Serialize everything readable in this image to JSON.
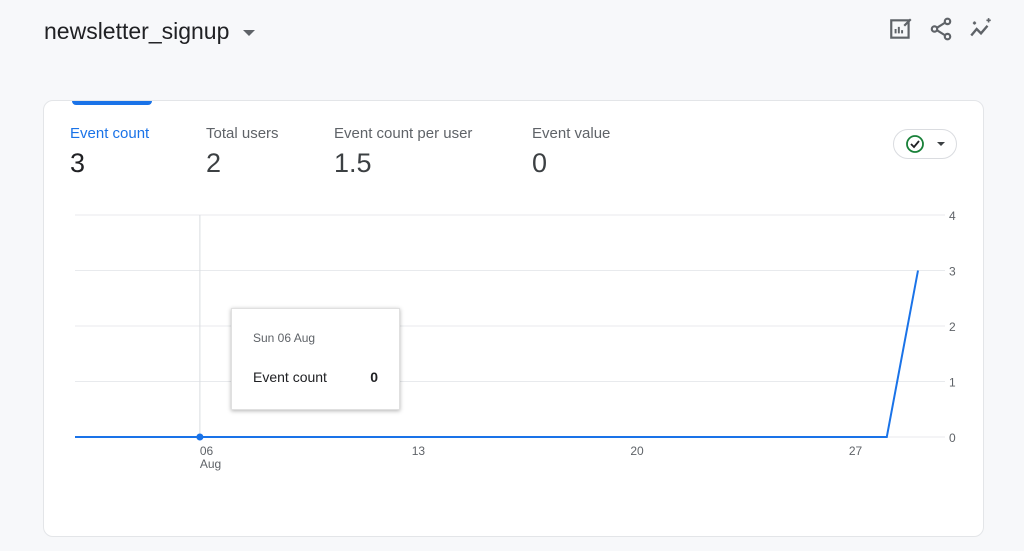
{
  "header": {
    "title": "newsletter_signup"
  },
  "toolbar": {
    "icons": [
      "edit-chart-icon",
      "share-icon",
      "insights-icon"
    ]
  },
  "metrics": [
    {
      "label": "Event count",
      "value": "3"
    },
    {
      "label": "Total users",
      "value": "2"
    },
    {
      "label": "Event count per user",
      "value": "1.5"
    },
    {
      "label": "Event value",
      "value": "0"
    }
  ],
  "tooltip": {
    "date": "Sun 06 Aug",
    "metric": "Event count",
    "value": "0"
  },
  "chart_data": {
    "type": "line",
    "x": [
      2,
      3,
      4,
      5,
      6,
      7,
      8,
      9,
      10,
      11,
      12,
      13,
      14,
      15,
      16,
      17,
      18,
      19,
      20,
      21,
      22,
      23,
      24,
      25,
      26,
      27,
      28,
      29
    ],
    "series": [
      {
        "name": "Event count",
        "values": [
          0,
          0,
          0,
          0,
          0,
          0,
          0,
          0,
          0,
          0,
          0,
          0,
          0,
          0,
          0,
          0,
          0,
          0,
          0,
          0,
          0,
          0,
          0,
          0,
          0,
          0,
          0,
          3
        ]
      }
    ],
    "xticks": [
      {
        "x": 6,
        "label": "06",
        "sub": "Aug"
      },
      {
        "x": 13,
        "label": "13"
      },
      {
        "x": 20,
        "label": "20"
      },
      {
        "x": 27,
        "label": "27"
      }
    ],
    "yticks": [
      "0",
      "1",
      "2",
      "3",
      "4"
    ],
    "ylim": [
      0,
      4
    ],
    "highlight_x": 6,
    "color": "#1a73e8"
  }
}
